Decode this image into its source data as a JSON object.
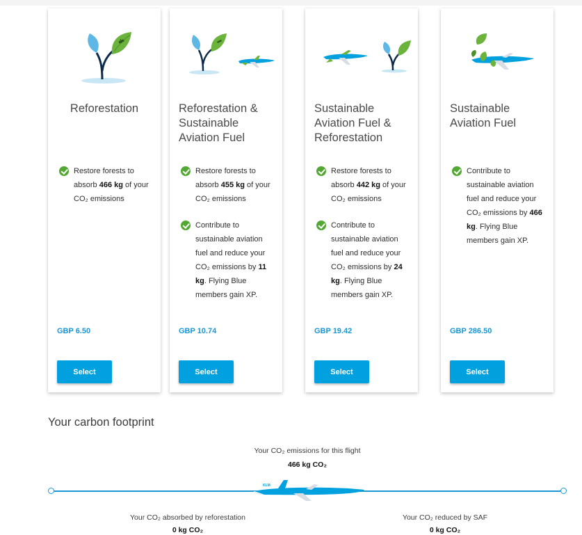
{
  "cards": [
    {
      "title": "Reforestation",
      "benefits": [
        {
          "pre": "Restore forests to absorb ",
          "bold": "466 kg",
          "post": " of your CO₂ emissions"
        }
      ],
      "price": "GBP 6.50",
      "select_label": "Select"
    },
    {
      "title": "Reforestation & Sustainable Aviation Fuel",
      "benefits": [
        {
          "pre": "Restore forests to absorb ",
          "bold": "455 kg",
          "post": " of your CO₂ emissions"
        },
        {
          "pre": "Contribute to sustainable aviation fuel and reduce your CO₂ emissions by ",
          "bold": "11 kg",
          "post": ". Flying Blue members gain XP."
        }
      ],
      "price": "GBP 10.74",
      "select_label": "Select"
    },
    {
      "title": "Sustainable Aviation Fuel & Reforestation",
      "benefits": [
        {
          "pre": "Restore forests to absorb ",
          "bold": "442 kg",
          "post": " of your CO₂ emissions"
        },
        {
          "pre": "Contribute to sustainable aviation fuel and reduce your CO₂ emissions by ",
          "bold": "24 kg",
          "post": ". Flying Blue members gain XP."
        }
      ],
      "price": "GBP 19.42",
      "select_label": "Select"
    },
    {
      "title": "Sustainable Aviation Fuel",
      "benefits": [
        {
          "pre": "Contribute to sustainable aviation fuel and reduce your CO₂ emissions by ",
          "bold": "466 kg",
          "post": ". Flying Blue members gain XP."
        }
      ],
      "price": "GBP 286.50",
      "select_label": "Select"
    }
  ],
  "footprint": {
    "heading": "Your carbon footprint",
    "flight_label": "Your CO₂ emissions for this flight",
    "flight_value": "466 kg CO₂",
    "absorbed_label": "Your CO₂ absorbed by reforestation",
    "absorbed_value": "0 kg CO₂",
    "saf_label": "Your CO₂ reduced by SAF",
    "saf_value": "0 kg CO₂"
  },
  "colors": {
    "accent": "#00a1de",
    "price": "#1a97d4",
    "check": "#52a832",
    "leaf_green": "#6bb33b",
    "leaf_blue": "#5fb7e5"
  },
  "icons": [
    "plant-icon",
    "airplane-icon",
    "check-circle-icon"
  ]
}
